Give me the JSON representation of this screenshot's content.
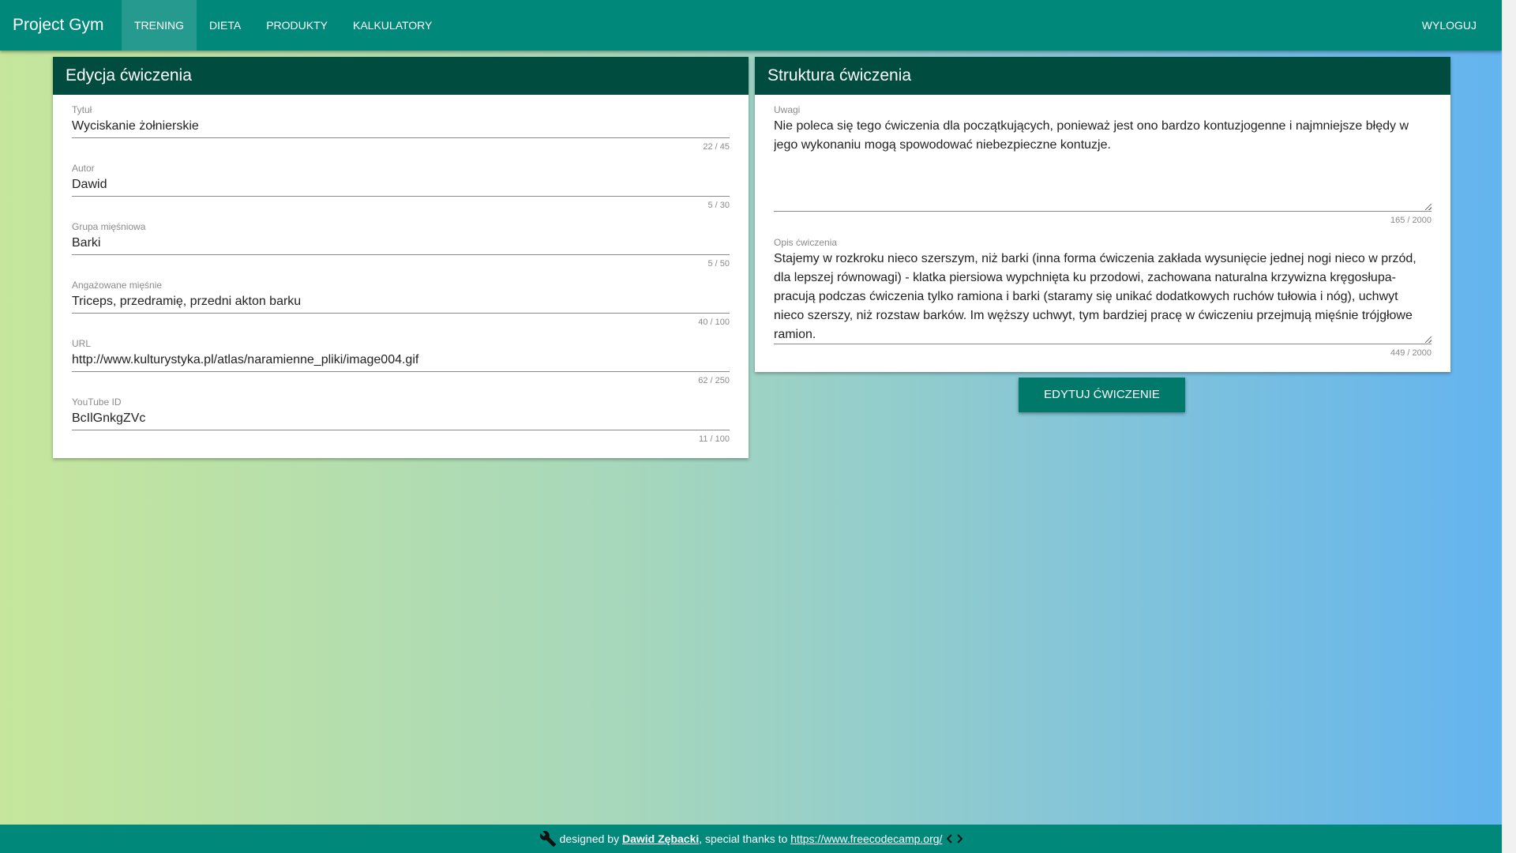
{
  "nav": {
    "brand": "Project Gym",
    "items": [
      {
        "label": "TRENING",
        "active": true
      },
      {
        "label": "DIETA",
        "active": false
      },
      {
        "label": "PRODUKTY",
        "active": false
      },
      {
        "label": "KALKULATORY",
        "active": false
      }
    ],
    "logout": "WYLOGUJ"
  },
  "edit_card": {
    "title": "Edycja ćwiczenia",
    "fields": [
      {
        "label": "Tytuł",
        "value": "Wyciskanie żołnierskie",
        "counter": "22 / 45"
      },
      {
        "label": "Autor",
        "value": "Dawid",
        "counter": "5 / 30"
      },
      {
        "label": "Grupa mięśniowa",
        "value": "Barki",
        "counter": "5 / 50"
      },
      {
        "label": "Angażowane mięśnie",
        "value": "Triceps, przedramię, przedni akton barku",
        "counter": "40 / 100"
      },
      {
        "label": "URL",
        "value": "http://www.kulturystyka.pl/atlas/naramienne_pliki/image004.gif",
        "counter": "62 / 250"
      },
      {
        "label": "YouTube ID",
        "value": "BcIlGnkgZVc",
        "counter": "11 / 100"
      }
    ]
  },
  "structure_card": {
    "title": "Struktura ćwiczenia",
    "notes": {
      "label": "Uwagi",
      "value": "Nie poleca się tego ćwiczenia dla początkujących, ponieważ jest ono bardzo kontuzjogenne i najmniejsze błędy w jego wykonaniu mogą spowodować niebezpieczne kontuzje.",
      "counter": "165 / 2000"
    },
    "description": {
      "label": "Opis ćwiczenia",
      "value": "Stajemy w rozkroku nieco szerszym, niż barki (inna forma ćwiczenia zakłada wysunięcie jednej nogi nieco w przód, dla lepszej równowagi) - klatka piersiowa wypchnięta ku przodowi, zachowana naturalna krzywizna kręgosłupa- pracują podczas ćwiczenia tylko ramiona i barki (staramy się unikać dodatkowych ruchów tułowia i nóg), uchwyt nieco szerszy, niż rozstaw barków. Im węższy uchwyt, tym bardziej pracę w ćwiczeniu przejmują mięśnie trójgłowe ramion.",
      "counter": "449 / 2000"
    }
  },
  "actions": {
    "edit_button": "EDYTUJ ĆWICZENIE"
  },
  "footer": {
    "prefix": "designed by",
    "author": "Dawid Zębacki",
    "middle": ", special thanks to",
    "link": "https://www.freecodecamp.org/"
  },
  "colors": {
    "primary": "#00897b",
    "header_dark": "#004d40",
    "button": "#00796b"
  }
}
